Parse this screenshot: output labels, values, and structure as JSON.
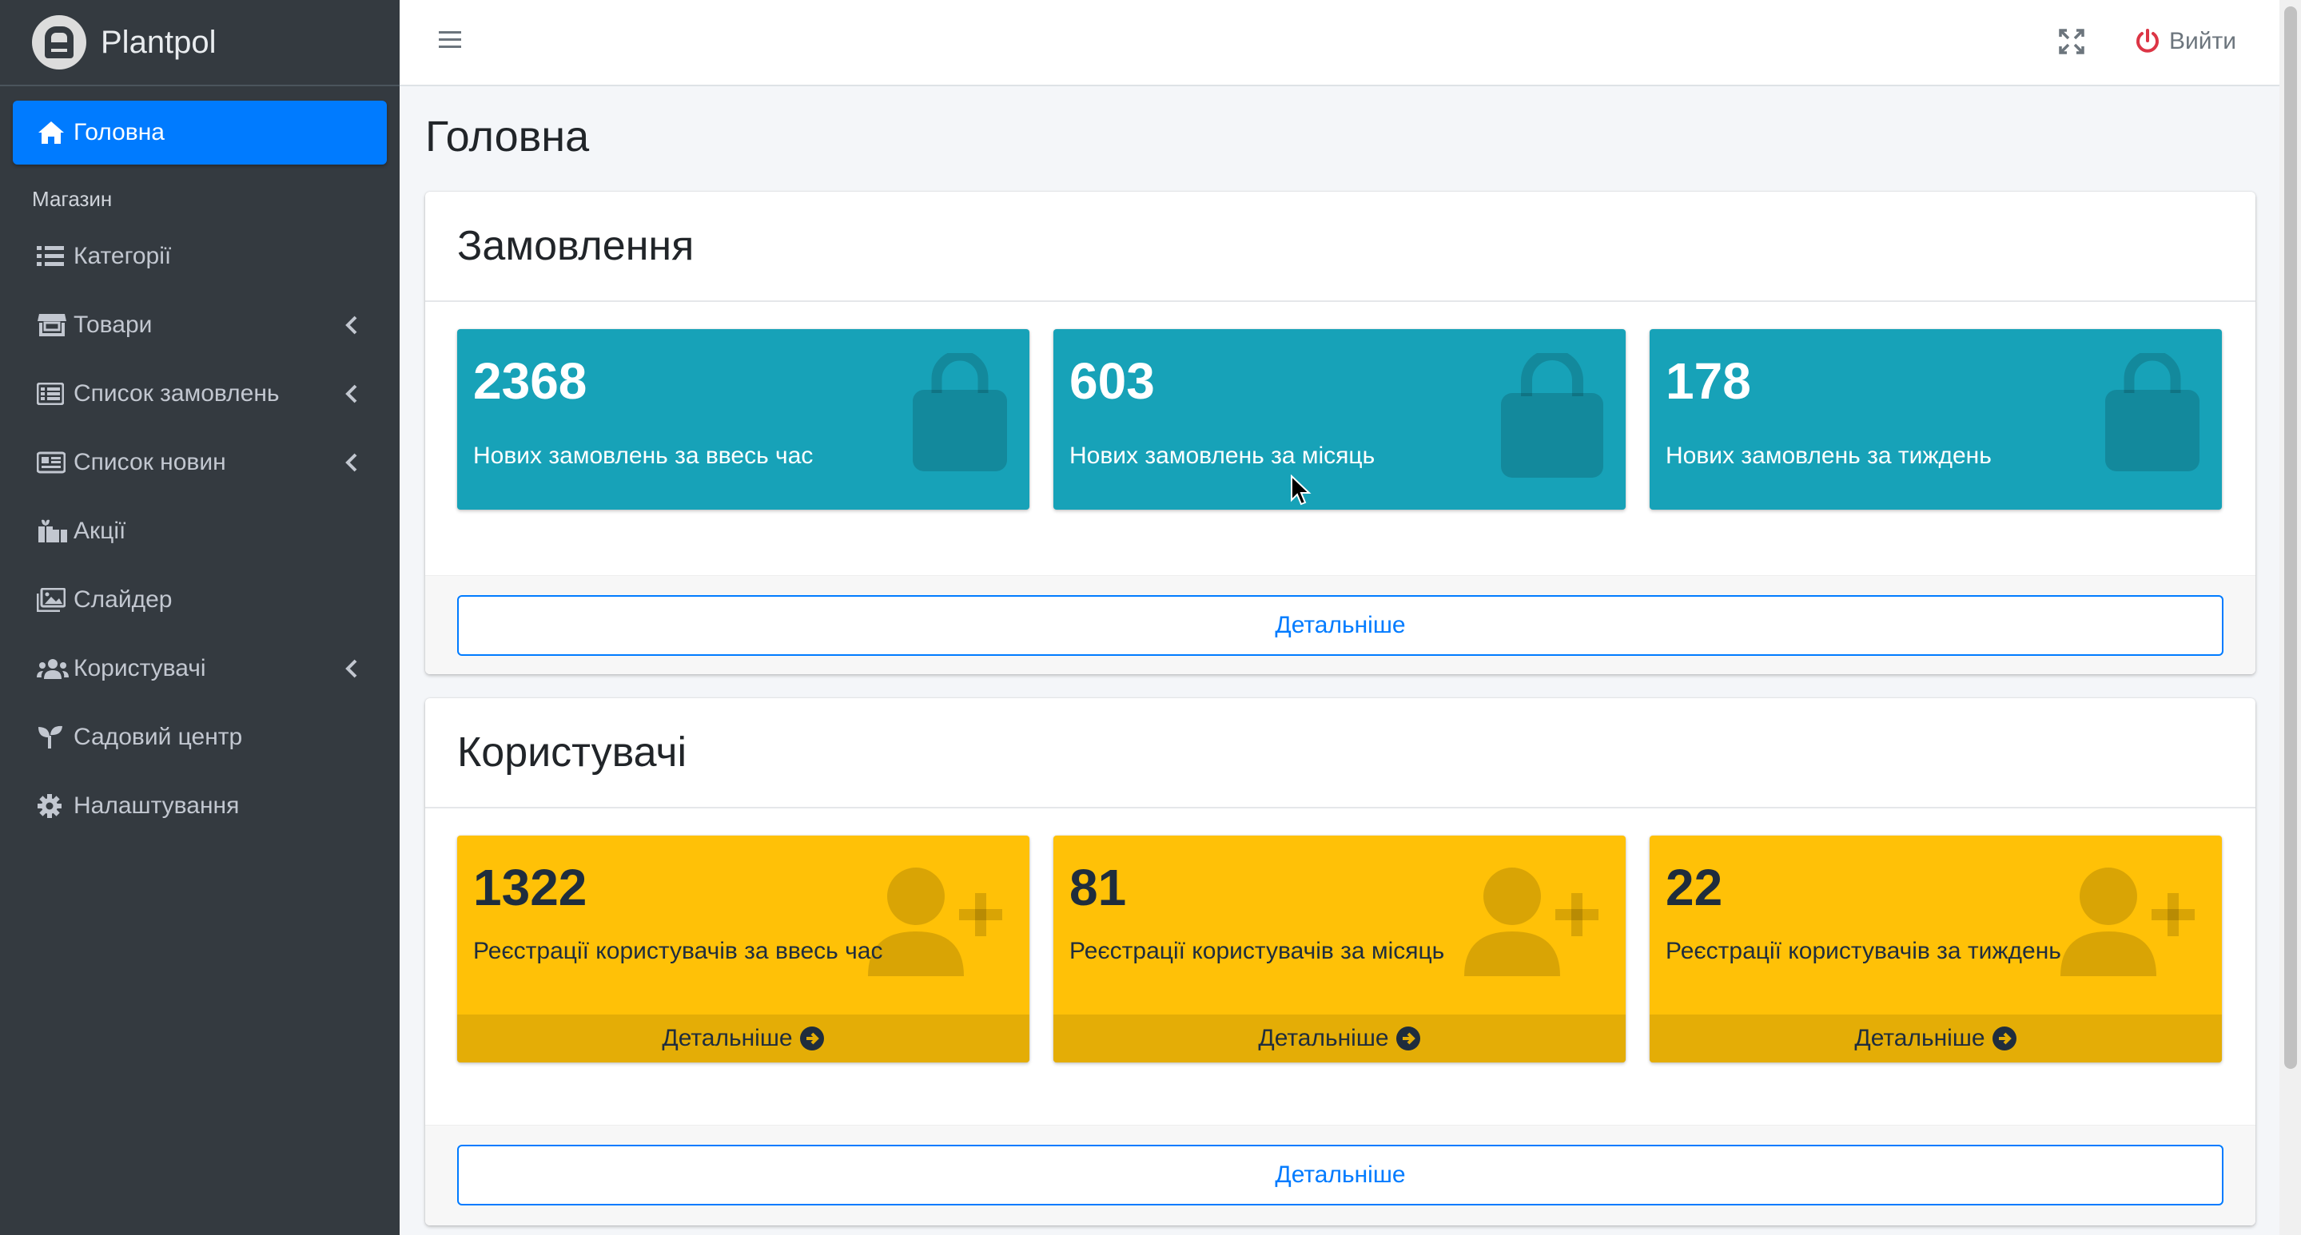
{
  "brand": {
    "name": "Plantpol"
  },
  "sidebar": {
    "active": {
      "label": "Головна",
      "icon": "home-icon"
    },
    "header": "Магазин",
    "items": [
      {
        "label": "Категорії",
        "icon": "list-icon",
        "has_chevron": false
      },
      {
        "label": "Товари",
        "icon": "store-icon",
        "has_chevron": true
      },
      {
        "label": "Список замовлень",
        "icon": "table-list-icon",
        "has_chevron": true
      },
      {
        "label": "Список новин",
        "icon": "newspaper-icon",
        "has_chevron": true
      },
      {
        "label": "Акції",
        "icon": "gifts-icon",
        "has_chevron": false
      },
      {
        "label": "Слайдер",
        "icon": "image-icon",
        "has_chevron": false
      },
      {
        "label": "Користувачі",
        "icon": "users-icon",
        "has_chevron": true
      },
      {
        "label": "Садовий центр",
        "icon": "seedling-icon",
        "has_chevron": false
      },
      {
        "label": "Налаштування",
        "icon": "gear-icon",
        "has_chevron": false
      }
    ]
  },
  "topbar": {
    "logout_label": "Вийти"
  },
  "page": {
    "title": "Головна"
  },
  "orders": {
    "title": "Замовлення",
    "boxes": [
      {
        "value": "2368",
        "label": "Нових замовлень за ввесь час"
      },
      {
        "value": "603",
        "label": "Нових замовлень за місяць"
      },
      {
        "value": "178",
        "label": "Нових замовлень за тиждень"
      }
    ],
    "details_label": "Детальніше"
  },
  "users": {
    "title": "Користувачі",
    "boxes": [
      {
        "value": "1322",
        "label": "Реєстрації користувачів за ввесь час",
        "more": "Детальніше"
      },
      {
        "value": "81",
        "label": "Реєстрації користувачів за місяць",
        "more": "Детальніше"
      },
      {
        "value": "22",
        "label": "Реєстрації користувачів за тиждень",
        "more": "Детальніше"
      }
    ],
    "details_label": "Детальніше"
  },
  "colors": {
    "sidebar_bg": "#343a40",
    "active_blue": "#007bff",
    "info": "#17a2b8",
    "warning": "#ffc107",
    "logout_icon": "#dc3545"
  }
}
